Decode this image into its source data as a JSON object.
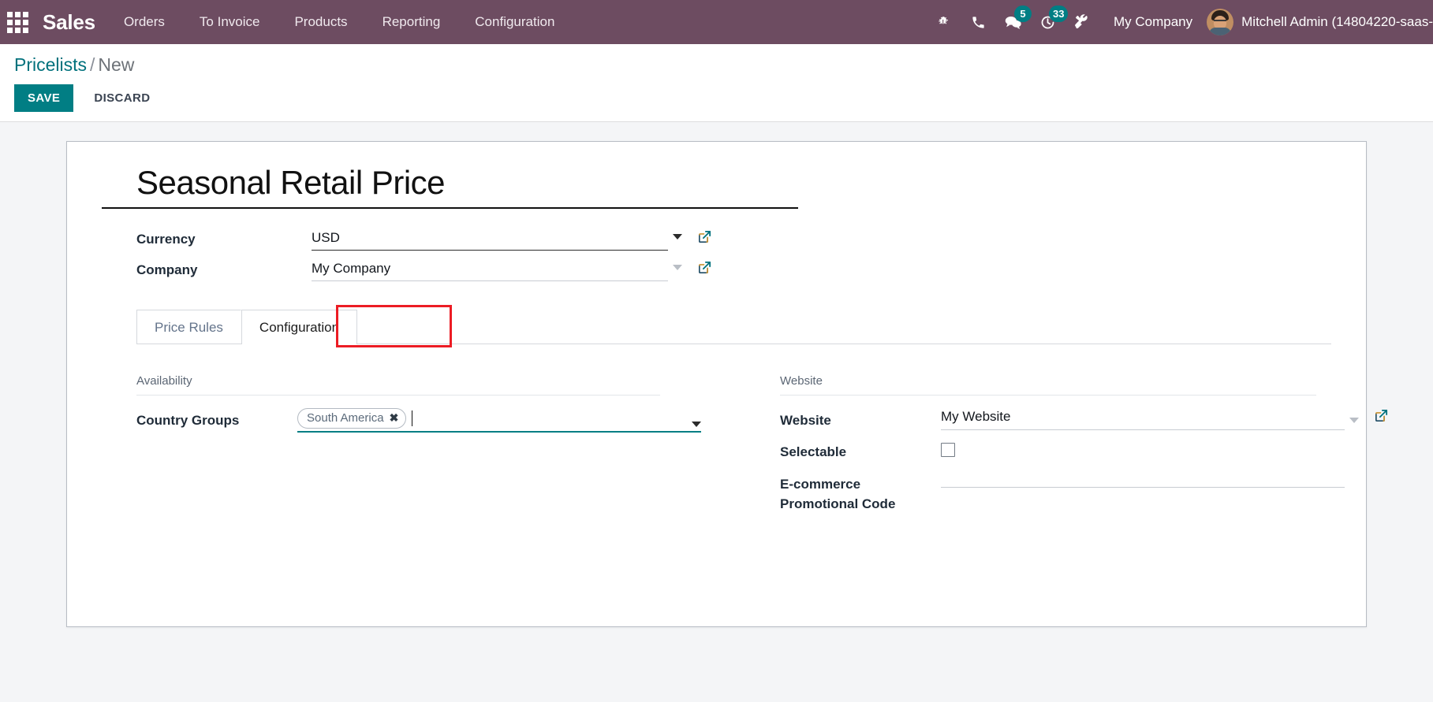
{
  "navbar": {
    "apps_icon": "apps-grid-icon",
    "brand": "Sales",
    "menu": [
      {
        "label": "Orders"
      },
      {
        "label": "To Invoice"
      },
      {
        "label": "Products"
      },
      {
        "label": "Reporting"
      },
      {
        "label": "Configuration"
      }
    ],
    "sys_icons": [
      {
        "name": "bug-icon",
        "badge": ""
      },
      {
        "name": "phone-icon",
        "badge": ""
      },
      {
        "name": "messages-icon",
        "badge": "5"
      },
      {
        "name": "activities-clock-icon",
        "badge": "33"
      },
      {
        "name": "tools-wrench-icon",
        "badge": ""
      }
    ],
    "messages_badge": "5",
    "activities_badge": "33",
    "company": "My Company",
    "user": "Mitchell Admin (14804220-saas-",
    "avatar_name": "user-avatar",
    "bg_color": "#6d4c61",
    "badge_color": "#017e84"
  },
  "control_panel": {
    "breadcrumb_root": "Pricelists",
    "breadcrumb_sep": "/",
    "breadcrumb_current": "New",
    "save_label": "SAVE",
    "discard_label": "DISCARD",
    "save_color": "#017e84"
  },
  "form": {
    "title": "Seasonal Retail Price",
    "fields": [
      {
        "label": "Currency",
        "value": "USD",
        "widget": "many2one",
        "caret": "chevron-down-icon",
        "caret_state": "active",
        "external_link": "external-link-icon"
      },
      {
        "label": "Company",
        "value": "My Company",
        "widget": "many2one",
        "caret": "chevron-down-icon",
        "caret_state": "muted",
        "external_link": "external-link-icon"
      }
    ]
  },
  "tabs": {
    "items": [
      {
        "label": "Price Rules",
        "active": false
      },
      {
        "label": "Configuration",
        "active": true
      }
    ],
    "highlight_color": "#ec1c24",
    "highlighted_tab": "Configuration"
  },
  "panel": {
    "left": {
      "group_title": "Availability",
      "field_label": "Country Groups",
      "tags": [
        {
          "label": "South America",
          "remove_icon": "close-icon"
        }
      ],
      "input_value": "",
      "caret": "chevron-down-icon",
      "focus_color": "#017e84"
    },
    "right": {
      "group_title": "Website",
      "rows": [
        {
          "label": "Website",
          "value": "My Website",
          "widget": "many2one",
          "caret": "chevron-down-icon",
          "external_link": "external-link-icon"
        },
        {
          "label": "Selectable",
          "value": "",
          "widget": "checkbox",
          "checked": false
        },
        {
          "label": "E-commerce Promotional Code",
          "value": "",
          "widget": "char"
        }
      ]
    }
  },
  "colors": {
    "page_bg": "#f4f5f7",
    "sheet_bg": "#ffffff",
    "accent_teal": "#017e84",
    "link_teal": "#00717c"
  }
}
